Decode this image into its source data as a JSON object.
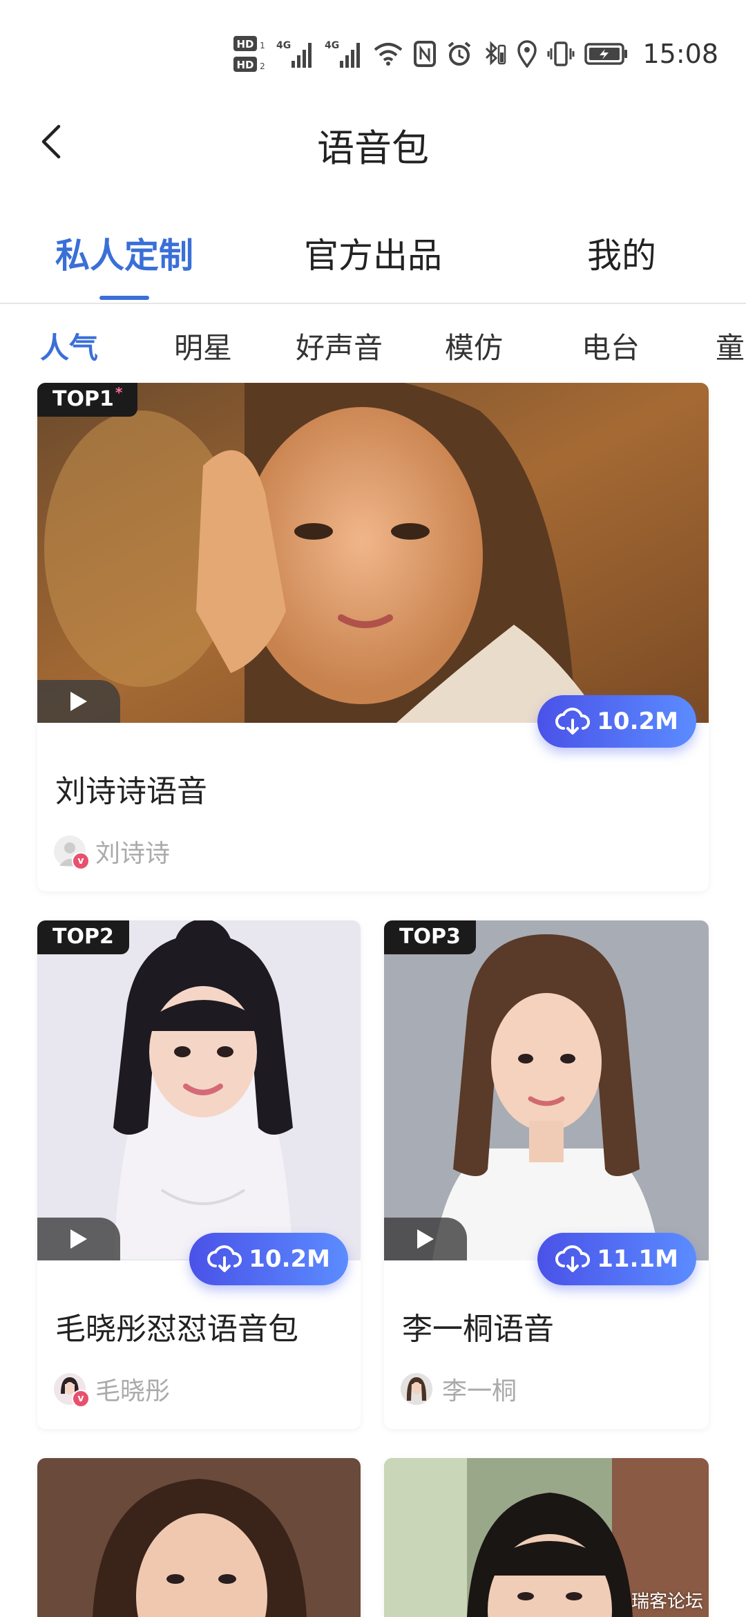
{
  "status_bar": {
    "hd1": "HD1",
    "hd2": "HD2",
    "sim1": "4G",
    "sim2": "4G",
    "time": "15:08"
  },
  "header": {
    "title": "语音包"
  },
  "main_tabs": [
    {
      "label": "私人定制",
      "active": true
    },
    {
      "label": "官方出品",
      "active": false
    },
    {
      "label": "我的",
      "active": false
    }
  ],
  "sub_tabs": [
    {
      "label": "人气",
      "active": true
    },
    {
      "label": "明星",
      "active": false
    },
    {
      "label": "好声音",
      "active": false
    },
    {
      "label": "模仿",
      "active": false
    },
    {
      "label": "电台",
      "active": false
    },
    {
      "label": "童",
      "active": false
    }
  ],
  "cards": [
    {
      "rank": "TOP1",
      "star": "*",
      "title": "刘诗诗语音",
      "author": "刘诗诗",
      "size": "10.2M",
      "verified": "v"
    },
    {
      "rank": "TOP2",
      "title": "毛晓彤怼怼语音包",
      "author": "毛晓彤",
      "size": "10.2M",
      "verified": "v"
    },
    {
      "rank": "TOP3",
      "title": "李一桐语音",
      "author": "李一桐",
      "size": "11.1M"
    }
  ],
  "watermark": "瑞客论坛",
  "colors": {
    "accent": "#3a6fd8",
    "pill_start": "#4a52e8",
    "pill_end": "#5b8cff",
    "verified": "#e8506d"
  }
}
